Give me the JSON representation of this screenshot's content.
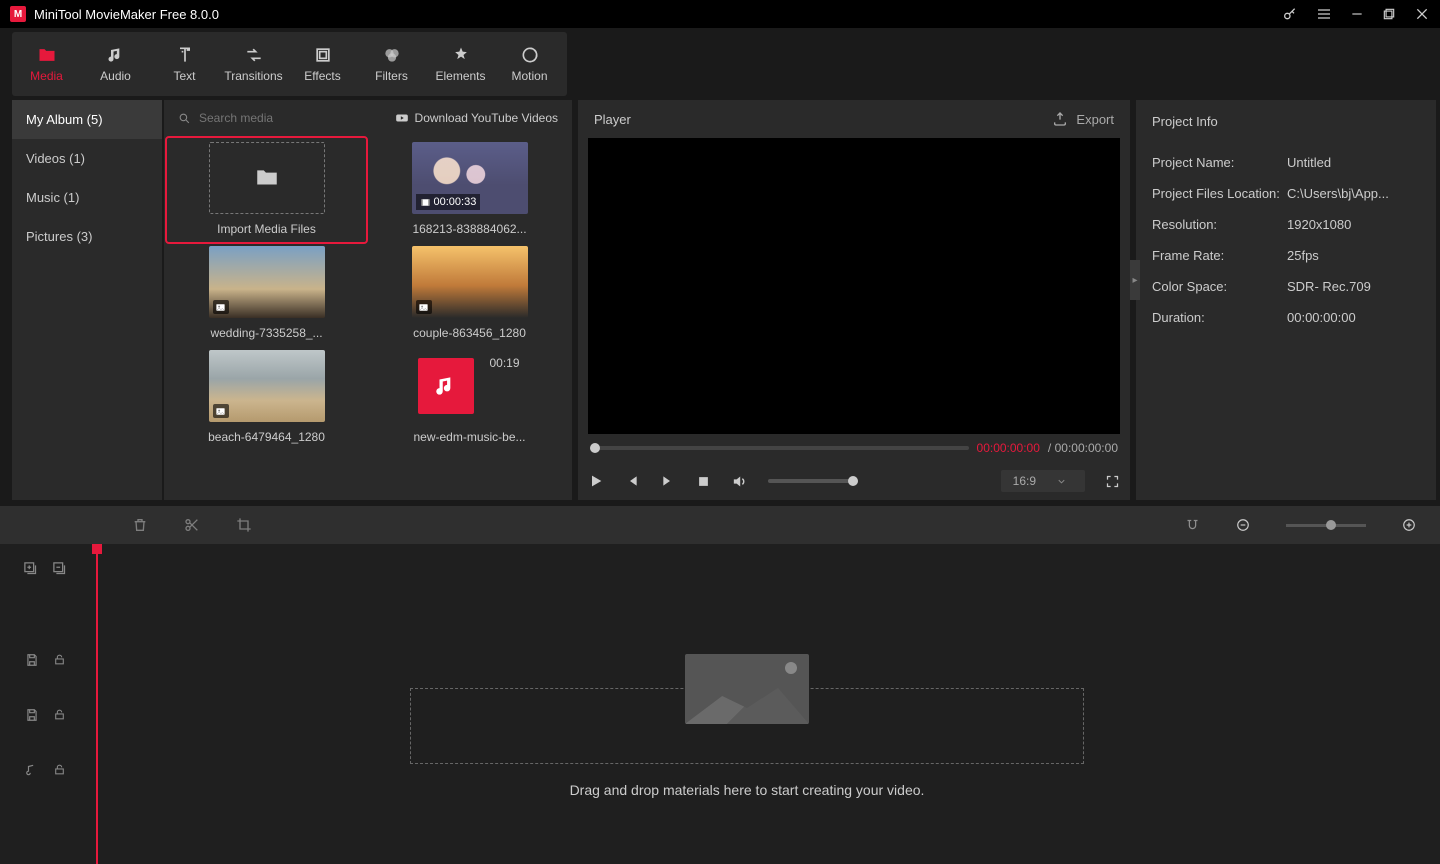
{
  "titlebar": {
    "title": "MiniTool MovieMaker Free 8.0.0"
  },
  "toptabs": [
    {
      "label": "Media"
    },
    {
      "label": "Audio"
    },
    {
      "label": "Text"
    },
    {
      "label": "Transitions"
    },
    {
      "label": "Effects"
    },
    {
      "label": "Filters"
    },
    {
      "label": "Elements"
    },
    {
      "label": "Motion"
    }
  ],
  "sidecats": [
    {
      "label": "My Album (5)"
    },
    {
      "label": "Videos (1)"
    },
    {
      "label": "Music (1)"
    },
    {
      "label": "Pictures (3)"
    }
  ],
  "search": {
    "placeholder": "Search media"
  },
  "yt": {
    "label": "Download YouTube Videos"
  },
  "media": {
    "import_label": "Import Media Files",
    "items": [
      {
        "caption": "168213-838884062...",
        "duration": "00:00:33"
      },
      {
        "caption": "wedding-7335258_..."
      },
      {
        "caption": "couple-863456_1280"
      },
      {
        "caption": "beach-6479464_1280"
      },
      {
        "caption": "new-edm-music-be...",
        "duration": "00:19"
      }
    ]
  },
  "player": {
    "title": "Player",
    "export": "Export",
    "cur": "00:00:00:00",
    "sep": " / ",
    "total": "00:00:00:00",
    "ratio": "16:9"
  },
  "info": {
    "title": "Project Info",
    "rows": [
      {
        "k": "Project Name:",
        "v": "Untitled"
      },
      {
        "k": "Project Files Location:",
        "v": "C:\\Users\\bj\\App..."
      },
      {
        "k": "Resolution:",
        "v": "1920x1080"
      },
      {
        "k": "Frame Rate:",
        "v": "25fps"
      },
      {
        "k": "Color Space:",
        "v": "SDR- Rec.709"
      },
      {
        "k": "Duration:",
        "v": "00:00:00:00"
      }
    ]
  },
  "timeline": {
    "droptext": "Drag and drop materials here to start creating your video."
  }
}
